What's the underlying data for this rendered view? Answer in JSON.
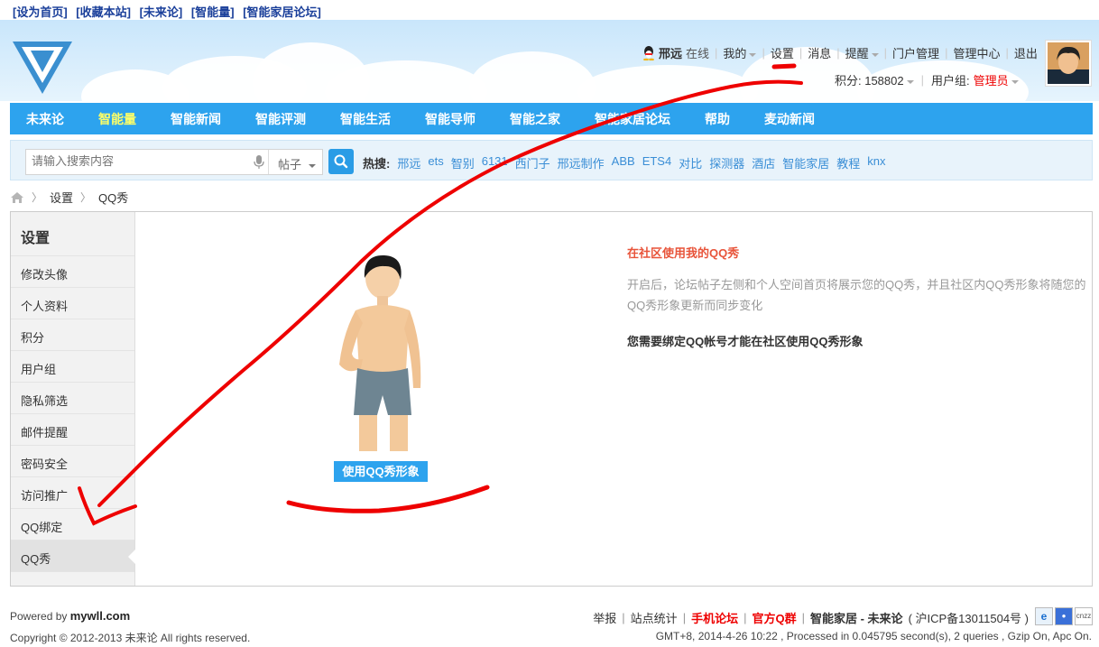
{
  "top_links": [
    "[设为首页]",
    "[收藏本站]",
    "[未来论]",
    "[智能量]",
    "[智能家居论坛]"
  ],
  "user": {
    "name": "邢远",
    "status": "在线",
    "menu": [
      "我的",
      "设置",
      "消息",
      "提醒",
      "门户管理",
      "管理中心",
      "退出"
    ],
    "points_label": "积分: 158802",
    "group_label": "用户组:",
    "group_value": "管理员"
  },
  "nav": {
    "items": [
      "未来论",
      "智能量",
      "智能新闻",
      "智能评测",
      "智能生活",
      "智能导师",
      "智能之家",
      "智能家居论坛",
      "帮助",
      "麦动新闻"
    ],
    "active_index": 1
  },
  "search": {
    "placeholder": "请输入搜索内容",
    "type": "帖子",
    "hot_label": "热搜:",
    "hot_terms": [
      "邢远",
      "ets",
      "智别",
      "6131",
      "西门子",
      "邢远制作",
      "ABB",
      "ETS4",
      "对比",
      "探测器",
      "酒店",
      "智能家居",
      "教程",
      "knx"
    ]
  },
  "breadcrumb": [
    "设置",
    "QQ秀"
  ],
  "sidebar": {
    "title": "设置",
    "items": [
      "修改头像",
      "个人资料",
      "积分",
      "用户组",
      "隐私筛选",
      "邮件提醒",
      "密码安全",
      "访问推广",
      "QQ绑定",
      "QQ秀"
    ],
    "active_index": 9
  },
  "main": {
    "use_button": "使用QQ秀形象",
    "info_title": "在社区使用我的QQ秀",
    "info_desc": "开启后，论坛帖子左侧和个人空间首页将展示您的QQ秀，并且社区内QQ秀形象将随您的QQ秀形象更新而同步变化",
    "info_note": "您需要绑定QQ帐号才能在社区使用QQ秀形象"
  },
  "footer": {
    "powered_prefix": "Powered by ",
    "powered_site": "mywll.com",
    "copyright": "Copyright © 2012-2013 未来论 All rights reserved.",
    "links": [
      "举报",
      "站点统计",
      "手机论坛",
      "官方Q群"
    ],
    "site_name": "智能家居 - 未来论",
    "icp": "( 沪ICP备13011504号 )",
    "stats": "GMT+8, 2014-4-26 10:22 , Processed in 0.045795 second(s), 2 queries , Gzip On, Apc On."
  },
  "colors": {
    "nav_bg": "#2da3ee",
    "accent_red": "#e00000",
    "link_blue": "#3a8ed6"
  }
}
